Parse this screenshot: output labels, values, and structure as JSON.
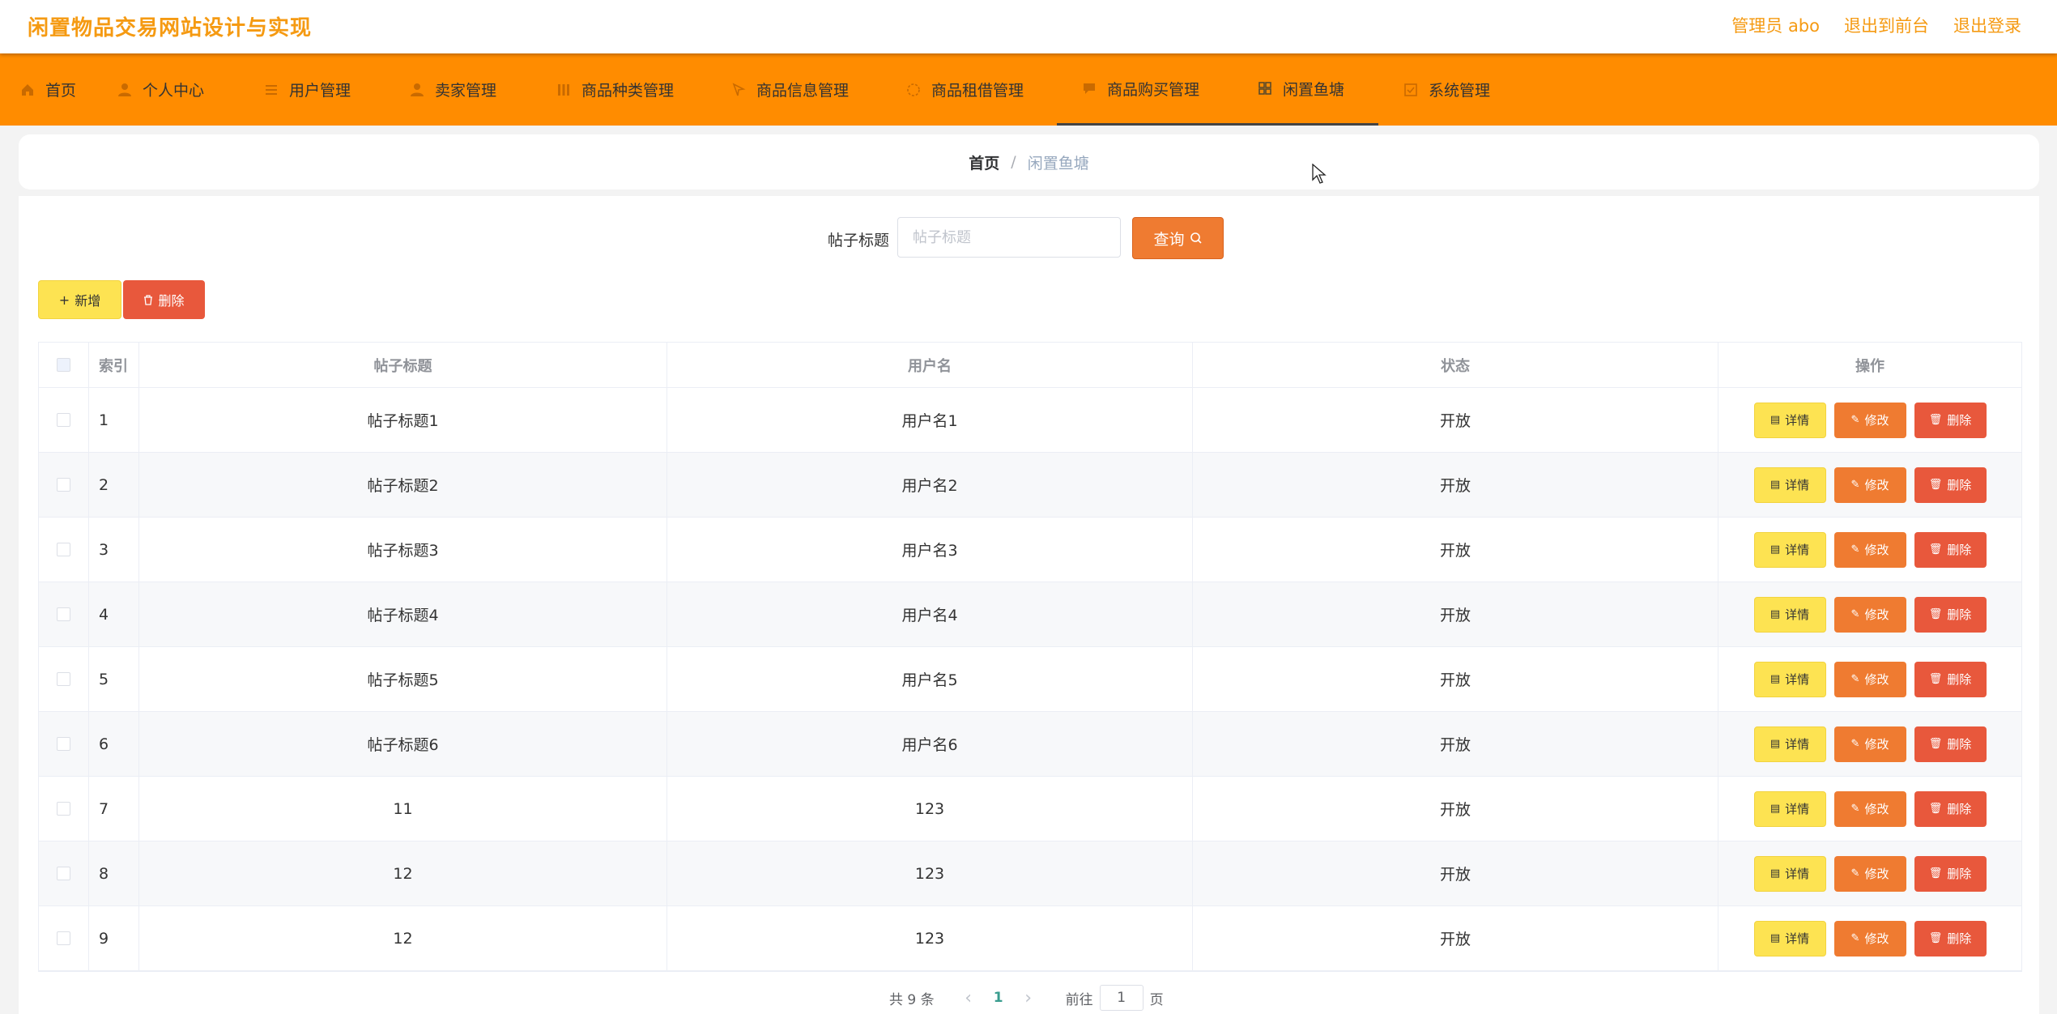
{
  "header": {
    "site_title": "闲置物品交易网站设计与实现",
    "admin_label": "管理员 abo",
    "to_front": "退出到前台",
    "logout": "退出登录"
  },
  "nav": {
    "items": [
      {
        "label": "首页",
        "icon": "home-icon"
      },
      {
        "label": "个人中心",
        "icon": "user-icon"
      },
      {
        "label": "用户管理",
        "icon": "list-icon"
      },
      {
        "label": "卖家管理",
        "icon": "user-icon"
      },
      {
        "label": "商品种类管理",
        "icon": "grid-icon"
      },
      {
        "label": "商品信息管理",
        "icon": "pin-icon"
      },
      {
        "label": "商品租借管理",
        "icon": "loading-icon"
      },
      {
        "label": "商品购买管理",
        "icon": "chat-icon"
      },
      {
        "label": "闲置鱼塘",
        "icon": "menu-icon"
      },
      {
        "label": "系统管理",
        "icon": "settings-icon"
      }
    ]
  },
  "breadcrumb": {
    "home": "首页",
    "separator": "/",
    "current": "闲置鱼塘"
  },
  "search": {
    "label": "帖子标题",
    "placeholder": "帖子标题",
    "value": "",
    "button": "查询"
  },
  "actions": {
    "add": "新增",
    "delete": "删除"
  },
  "table": {
    "headers": {
      "index": "索引",
      "title": "帖子标题",
      "username": "用户名",
      "status": "状态",
      "ops": "操作"
    },
    "row_buttons": {
      "detail": "详情",
      "edit": "修改",
      "delete": "删除"
    },
    "rows": [
      {
        "index": "1",
        "title": "帖子标题1",
        "username": "用户名1",
        "status": "开放"
      },
      {
        "index": "2",
        "title": "帖子标题2",
        "username": "用户名2",
        "status": "开放"
      },
      {
        "index": "3",
        "title": "帖子标题3",
        "username": "用户名3",
        "status": "开放"
      },
      {
        "index": "4",
        "title": "帖子标题4",
        "username": "用户名4",
        "status": "开放"
      },
      {
        "index": "5",
        "title": "帖子标题5",
        "username": "用户名5",
        "status": "开放"
      },
      {
        "index": "6",
        "title": "帖子标题6",
        "username": "用户名6",
        "status": "开放"
      },
      {
        "index": "7",
        "title": "11",
        "username": "123",
        "status": "开放"
      },
      {
        "index": "8",
        "title": "12",
        "username": "123",
        "status": "开放"
      },
      {
        "index": "9",
        "title": "12",
        "username": "123",
        "status": "开放"
      }
    ]
  },
  "pagination": {
    "total": "共 9 条",
    "current": "1",
    "goto": "前往",
    "input": "1",
    "page_unit": "页"
  },
  "colors": {
    "brand": "#ff8c00",
    "accent_orange": "#ef7b31",
    "yellow": "#fde352",
    "red": "#e8583c"
  }
}
